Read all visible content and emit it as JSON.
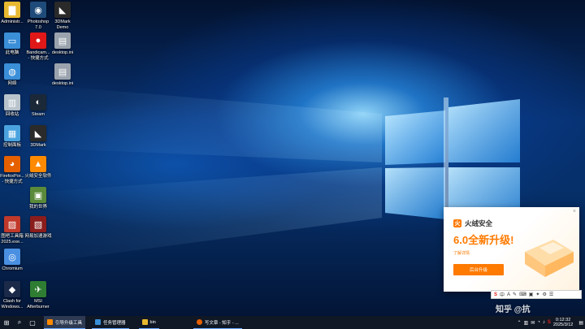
{
  "desktop_icons": [
    {
      "label": "Administr...",
      "icon": "folder-user-icon",
      "color": "#e8b930",
      "glyph": "▇"
    },
    {
      "label": "Photoshop\n7.0",
      "icon": "photoshop-icon",
      "color": "#1e4b7a",
      "glyph": "◉"
    },
    {
      "label": "3DMark\nDemo",
      "icon": "3dmark-icon",
      "color": "#2a2a2a",
      "glyph": "◣"
    },
    {
      "label": "此电脑",
      "icon": "computer-icon",
      "color": "#3a8fd8",
      "glyph": "▭"
    },
    {
      "label": "Bandicam...\n- 快捷方式",
      "icon": "bandicam-icon",
      "color": "#e01818",
      "glyph": "●"
    },
    {
      "label": "desktop.ini",
      "icon": "file-icon",
      "color": "#9aa3ad",
      "glyph": "▤"
    },
    {
      "label": "网络",
      "icon": "network-icon",
      "color": "#3a8fd8",
      "glyph": "◍"
    },
    {
      "label": "desktop.ini",
      "icon": "file-icon",
      "color": "#9aa3ad",
      "glyph": "▤"
    },
    {
      "label": "回收站",
      "icon": "recycle-bin-icon",
      "color": "#b8c3cc",
      "glyph": "▥"
    },
    {
      "label": "Steam",
      "icon": "steam-icon",
      "color": "#1b2838",
      "glyph": "◐"
    },
    {
      "label": "控制面板",
      "icon": "control-panel-icon",
      "color": "#4aa3df",
      "glyph": "▦"
    },
    {
      "label": "3DMark",
      "icon": "3dmark-icon",
      "color": "#2a2a2a",
      "glyph": "◣"
    },
    {
      "label": "FirefoxPor...\n- 快捷方式",
      "icon": "firefox-icon",
      "color": "#e66000",
      "glyph": "◕"
    },
    {
      "label": "火绒安全软件",
      "icon": "huorong-icon",
      "color": "#ff8a00",
      "glyph": "▲"
    },
    {
      "label": "我的世界",
      "icon": "minecraft-icon",
      "color": "#5a8a3a",
      "glyph": "▣"
    },
    {
      "label": "图吧工具箱\n2025.exe...",
      "icon": "toolbox-icon",
      "color": "#c0392b",
      "glyph": "▨"
    },
    {
      "label": "网易加速游戏",
      "icon": "netease-icon",
      "color": "#8a1c1c",
      "glyph": "▧"
    },
    {
      "label": "Chromium",
      "icon": "chromium-icon",
      "color": "#4a90e2",
      "glyph": "◎"
    },
    {
      "label": "Clash for\nWindows...",
      "icon": "clash-icon",
      "color": "#1c2a4a",
      "glyph": "◆"
    },
    {
      "label": "MSI\nAfterburner",
      "icon": "afterburner-icon",
      "color": "#2e7d32",
      "glyph": "✈"
    }
  ],
  "popup": {
    "brand_logo": "火",
    "brand_name": "火绒安全",
    "headline": "6.0全新升级!",
    "subtitle": "了解详情",
    "button_label": "后台升级",
    "close": "×"
  },
  "ime_bar": {
    "logo": "S",
    "items": [
      "中",
      "A",
      "✎",
      "⌨",
      "▣",
      "✦",
      "⚙",
      "☰"
    ]
  },
  "watermark": "知乎 @抗",
  "taskbar": {
    "start_glyph": "⊞",
    "search_glyph": "⌕",
    "taskview_glyph": "▢",
    "apps": [
      {
        "label": "引导升级工具",
        "color": "#ff8a00",
        "active": true
      },
      {
        "label": "任务管理器",
        "color": "#3a8fd8",
        "active": false
      },
      {
        "label": "bin",
        "color": "#e8b930",
        "active": false
      },
      {
        "label": "写文章 - 知乎 - ...",
        "color": "#e66000",
        "active": false
      }
    ],
    "tray_icons": [
      "⌃",
      "▥",
      "✉",
      "◔",
      "♪",
      "S"
    ],
    "time": "0:12:32",
    "date": "2025/3/12",
    "notify_glyph": "▤"
  }
}
